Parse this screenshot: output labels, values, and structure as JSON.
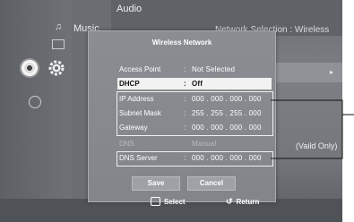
{
  "background": {
    "menu_music": "Music",
    "menu_audio": "Audio",
    "header_right": "Network Selection : Wireless",
    "side_note": "(Vaild Only)"
  },
  "dialog": {
    "title": "Wireless Network",
    "rows": [
      {
        "label": "Access Point",
        "colon": ":",
        "value": "Not Selected"
      },
      {
        "label": "DHCP",
        "colon": ":",
        "value": "Off"
      },
      {
        "label": "IP Address",
        "colon": ":",
        "value": "000 . 000 . 000 . 000"
      },
      {
        "label": "Subnet Mask",
        "colon": ":",
        "value": "255 . 255 . 255 . 000"
      },
      {
        "label": "Gateway",
        "colon": ":",
        "value": "000 . 000 . 000 . 000"
      },
      {
        "label": "DNS",
        "colon": "",
        "value": "Manual"
      },
      {
        "label": "DNS Server",
        "colon": ":",
        "value": "000 . 000 . 000 . 000"
      }
    ],
    "save_label": "Save",
    "cancel_label": "Cancel"
  },
  "footer": {
    "select_label": "Select",
    "return_label": "Return"
  },
  "icons": {
    "music": "music-note-icon",
    "photo": "photo-icon",
    "disc": "disc-icon",
    "settings": "gear-icon",
    "network": "globe-icon"
  }
}
